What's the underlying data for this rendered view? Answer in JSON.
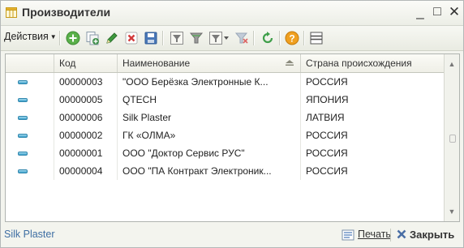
{
  "window": {
    "title": "Производители",
    "minimize_glyph": "_",
    "maximize_glyph": "□",
    "close_glyph": "✕"
  },
  "toolbar": {
    "actions_label": "Действия",
    "actions_caret": "▼",
    "buttons": [
      {
        "icon": "add-icon",
        "color": "#5ab04a"
      },
      {
        "icon": "copy-icon",
        "color": "#3f8f4a"
      },
      {
        "icon": "edit-icon",
        "color": "#3e9a3e"
      },
      {
        "icon": "delete-icon",
        "color": "#d23b3b"
      },
      {
        "icon": "save-icon",
        "color": "#4a78b8"
      },
      {
        "icon": "filter-settings-icon",
        "color": "#7a7a7a"
      },
      {
        "icon": "filter-icon",
        "color": "#7a7a7a"
      },
      {
        "icon": "filter-list-icon",
        "color": "#7a7a7a"
      },
      {
        "icon": "clear-filter-icon",
        "color": "#9aa7b8"
      },
      {
        "icon": "refresh-icon",
        "color": "#3f9f4a"
      },
      {
        "icon": "help-icon",
        "color": "#f0a020"
      },
      {
        "icon": "list-icon",
        "color": "#555555"
      }
    ]
  },
  "table": {
    "columns": [
      {
        "key": "marker",
        "label": ""
      },
      {
        "key": "code",
        "label": "Код"
      },
      {
        "key": "name",
        "label": "Наименование"
      },
      {
        "key": "country",
        "label": "Страна происхождения"
      }
    ],
    "rows": [
      {
        "code": "00000003",
        "name": "\"ООО Берёзка Электронные К...",
        "country": "РОССИЯ"
      },
      {
        "code": "00000005",
        "name": "QTECH",
        "country": "ЯПОНИЯ"
      },
      {
        "code": "00000006",
        "name": "Silk Plaster",
        "country": "ЛАТВИЯ"
      },
      {
        "code": "00000002",
        "name": "ГК «ОЛМА»",
        "country": "РОССИЯ"
      },
      {
        "code": "00000001",
        "name": "ООО \"Доктор Сервис РУС\"",
        "country": "РОССИЯ"
      },
      {
        "code": "00000004",
        "name": "ООО \"ПА Контракт Электроник...",
        "country": "РОССИЯ"
      }
    ],
    "scroll_up": "▲",
    "scroll_down": "▼"
  },
  "status": {
    "current_item": "Silk Plaster",
    "print_label": "Печать",
    "close_label": "Закрыть"
  }
}
